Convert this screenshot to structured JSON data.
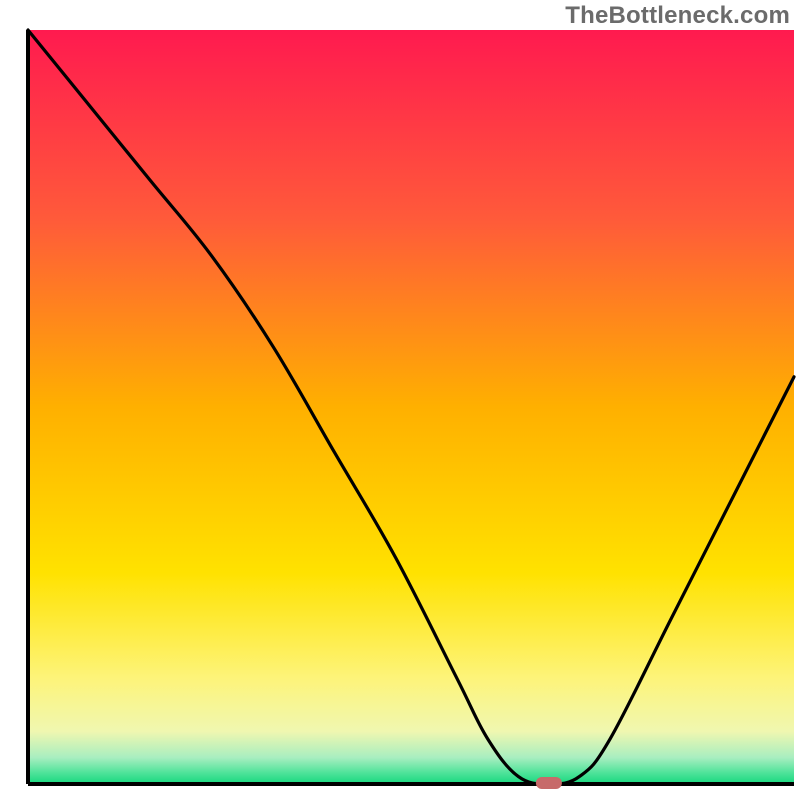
{
  "watermark": "TheBottleneck.com",
  "chart_data": {
    "type": "line",
    "title": "",
    "xlabel": "",
    "ylabel": "",
    "xlim": [
      0,
      100
    ],
    "ylim": [
      0,
      100
    ],
    "grid": false,
    "x": [
      0,
      8,
      16,
      24,
      32,
      40,
      48,
      56,
      60,
      64,
      68,
      72,
      76,
      84,
      92,
      100
    ],
    "values": [
      100,
      90,
      80,
      70,
      58,
      44,
      30,
      14,
      6,
      1,
      0,
      1,
      6,
      22,
      38,
      54
    ],
    "marker": {
      "x": 68,
      "y": 0,
      "color": "#c76a6a"
    },
    "gradient_stops": [
      {
        "offset": 0.0,
        "color": "#ff1a4f"
      },
      {
        "offset": 0.25,
        "color": "#ff5a3a"
      },
      {
        "offset": 0.5,
        "color": "#ffb000"
      },
      {
        "offset": 0.72,
        "color": "#ffe200"
      },
      {
        "offset": 0.86,
        "color": "#fdf47a"
      },
      {
        "offset": 0.93,
        "color": "#f0f7b0"
      },
      {
        "offset": 0.965,
        "color": "#a8eec0"
      },
      {
        "offset": 0.985,
        "color": "#4fe39a"
      },
      {
        "offset": 1.0,
        "color": "#17d87e"
      }
    ],
    "axis_color": "#000000",
    "line_color": "#000000"
  }
}
